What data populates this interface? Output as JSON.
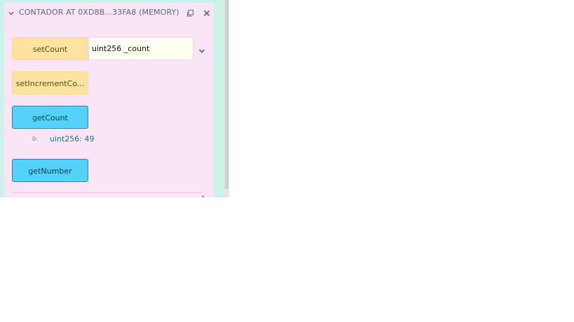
{
  "panel": {
    "title": "CONTADOR AT 0XD8B...33FA8 (MEMORY)"
  },
  "functions": {
    "setCount": {
      "label": "setCount",
      "param_placeholder": "uint256 _count"
    },
    "setIncrementCount": {
      "label": "setIncrementCo..."
    },
    "getCount": {
      "label": "getCount",
      "result_index": "0:",
      "result": "uint256: 49"
    },
    "getNumber": {
      "label": "getNumber"
    }
  },
  "icons": {
    "collapse": "chevron-down-icon",
    "copy": "copy-icon",
    "close": "close-icon",
    "expand": "chevron-down-icon"
  },
  "colors": {
    "background": "#c9f2e8",
    "panel": "#fae5f6",
    "transact_button": "#fde2a0",
    "call_button": "#55d2f8",
    "result_text": "#2a6a8a"
  }
}
